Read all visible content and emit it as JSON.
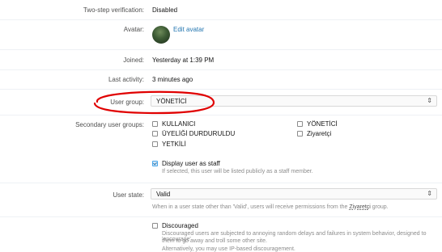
{
  "fields": {
    "two_step": {
      "label": "Two-step verification:",
      "value": "Disabled"
    },
    "avatar": {
      "label": "Avatar:",
      "edit_link": "Edit avatar"
    },
    "joined": {
      "label": "Joined:",
      "value": "Yesterday at 1:39 PM"
    },
    "last_activity": {
      "label": "Last activity:",
      "value": "3 minutes ago"
    },
    "user_group": {
      "label": "User group:",
      "selected": "YÖNETİCİ"
    },
    "secondary_groups": {
      "label": "Secondary user groups:",
      "options": [
        {
          "label": "KULLANICI",
          "checked": false
        },
        {
          "label": "YÖNETİCİ",
          "checked": false
        },
        {
          "label": "ÜYELİĞİ DURDURULDU",
          "checked": false
        },
        {
          "label": "Ziyaretçi",
          "checked": false
        },
        {
          "label": "YETKİLİ",
          "checked": false
        }
      ]
    },
    "staff": {
      "label": "Display user as staff",
      "checked": true,
      "hint": "If selected, this user will be listed publicly as a staff member."
    },
    "user_state": {
      "label": "User state:",
      "selected": "Valid",
      "hint_prefix": "When in a user state other than 'Valid', users will receive permissions from the",
      "hint_group": "Ziyaretçi",
      "hint_suffix": "group."
    },
    "discouraged": {
      "label": "Discouraged",
      "checked": false,
      "hint_line1": "Discouraged users are subjected to annoying random delays and failures in system behavior, designed to 'encourage'",
      "hint_line2": "them to go away and troll some other site.",
      "hint_line3": "Alternatively, you may use IP-based discouragement."
    }
  },
  "colors": {
    "link": "#2577b1",
    "annotation": "#e00000",
    "checkbox_on": "#47a7eb"
  }
}
